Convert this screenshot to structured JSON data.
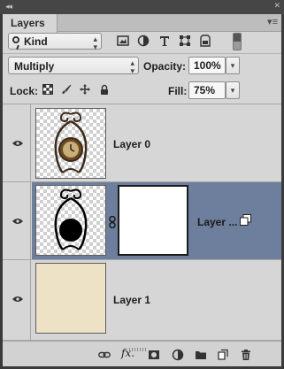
{
  "window": {
    "collapse_glyph": "◂◂",
    "close_glyph": "✕"
  },
  "panel": {
    "tab_label": "Layers",
    "menu_glyph": "▾≡"
  },
  "filter": {
    "kind_label": "Kind",
    "kind_icon": "search-icon",
    "icons": [
      "image-filter-icon",
      "adjustment-filter-icon",
      "type-filter-icon",
      "shape-filter-icon",
      "smart-object-filter-icon"
    ],
    "toggle_state": "off"
  },
  "blend": {
    "mode": "Multiply",
    "opacity_label": "Opacity:",
    "opacity_value": "100%"
  },
  "lock": {
    "label": "Lock:",
    "icons": [
      "lock-transparent-icon",
      "lock-pixels-icon",
      "lock-position-icon",
      "lock-all-icon"
    ],
    "fill_label": "Fill:",
    "fill_value": "75%"
  },
  "layers": [
    {
      "name": "Layer 0",
      "visible": true,
      "selected": false
    },
    {
      "name": "Layer ...",
      "visible": true,
      "selected": true,
      "has_mask": true
    },
    {
      "name": "Layer 1",
      "visible": true,
      "selected": false,
      "fill_color": "#ede2c6"
    }
  ],
  "colors": {
    "selection": "#6d7f9c",
    "panel_bg": "#d6d6d6",
    "layer1_fill": "#ede2c6"
  },
  "bottom": {
    "fx_label": "fx.",
    "icons": [
      "link-layers-icon",
      "layer-style-icon",
      "add-mask-icon",
      "adjustment-layer-icon",
      "new-group-icon",
      "new-layer-icon",
      "delete-layer-icon"
    ]
  }
}
